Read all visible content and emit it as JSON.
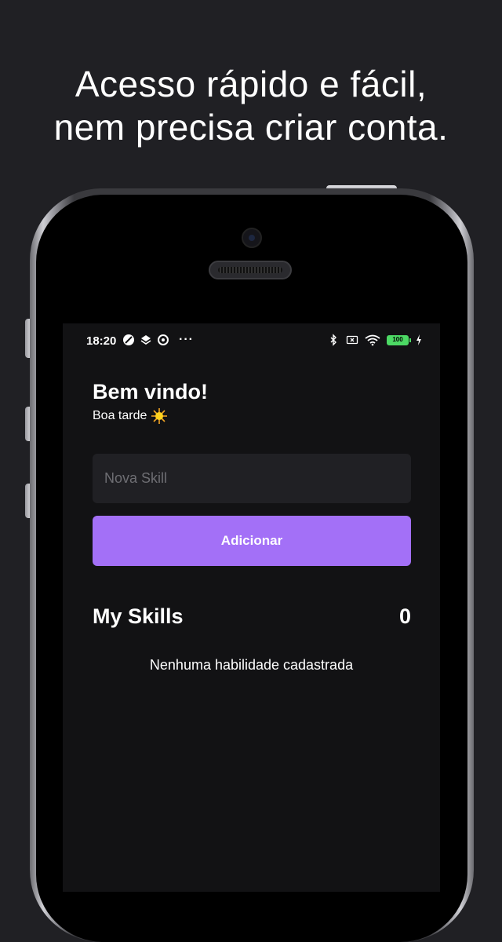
{
  "headline": {
    "line1": "Acesso rápido e fácil,",
    "line2": "nem precisa criar conta."
  },
  "status_bar": {
    "time": "18:20",
    "left_icons": [
      "moon-icon",
      "layers-icon",
      "target-icon"
    ],
    "more": "···",
    "right_icons": [
      "bluetooth-icon",
      "no-sim-icon",
      "wifi-icon",
      "battery-icon",
      "charging-icon"
    ],
    "battery_level": "100"
  },
  "greeting": {
    "title": "Bem vindo!",
    "subtitle": "Boa tarde",
    "emoji": "sun-icon"
  },
  "form": {
    "input_placeholder": "Nova Skill",
    "input_value": "",
    "add_button_label": "Adicionar"
  },
  "skills": {
    "title": "My Skills",
    "count": "0",
    "empty_message": "Nenhuma habilidade cadastrada"
  },
  "colors": {
    "background": "#202024",
    "screen": "#121214",
    "input_bg": "#202024",
    "accent": "#a370f7",
    "battery": "#4cd964"
  }
}
